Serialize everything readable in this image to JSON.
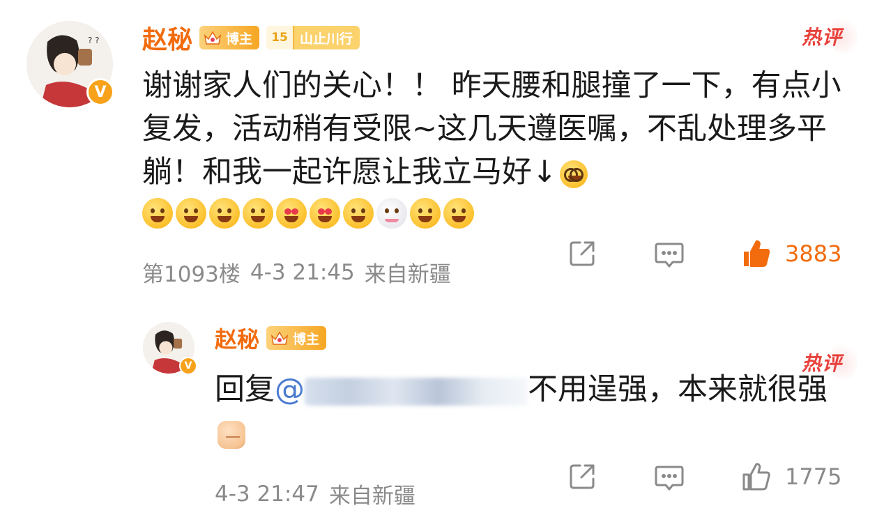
{
  "colors": {
    "username": "#f26b0d",
    "hot": "#e8413c",
    "mention": "#4a7bd0",
    "meta": "#8a8a8a",
    "liked": "#f26b0d"
  },
  "comment1": {
    "username": "赵秘",
    "badge_blogger": "博主",
    "badge_level": "15",
    "badge_fan_title": "山止川行",
    "hot_label": "热评",
    "text": "谢谢家人们的关心！！ 昨天腰和腿撞了一下，有点小复发，活动稍有受限~这几天遵医嘱，不乱处理多平躺！和我一起许愿让我立马好↓",
    "emojis": [
      "pray-icon",
      "pray-icon",
      "grin-icon",
      "laugh-icon",
      "heart-eyes-icon",
      "kiss-icon",
      "pray-icon",
      "cat-icon",
      "smug-icon",
      "smirk-icon"
    ],
    "floor": "第1093楼",
    "time": "4-3 21:45",
    "location": "来自新疆",
    "likes": "3883",
    "liked": true
  },
  "comment2": {
    "username": "赵秘",
    "badge_blogger": "博主",
    "hot_label": "热评",
    "reply_prefix": "回复",
    "mention": "@",
    "text_after": "不用逞强，本来就很强",
    "time": "4-3 21:47",
    "location": "来自新疆",
    "likes": "1775",
    "liked": false
  }
}
